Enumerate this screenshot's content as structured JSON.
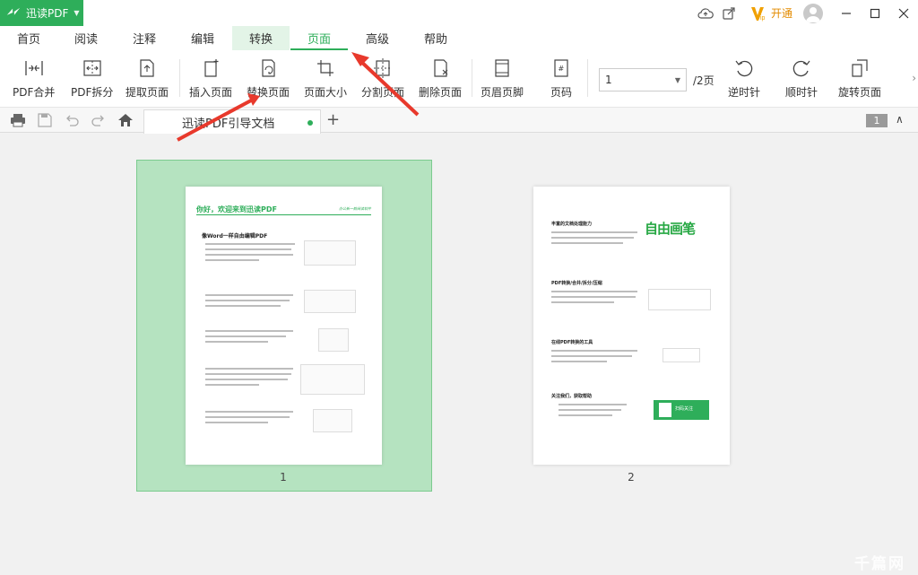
{
  "app": {
    "name": "迅读PDF"
  },
  "titlebar": {
    "vip_text": "开通"
  },
  "menu": {
    "tabs": [
      "首页",
      "阅读",
      "注释",
      "编辑",
      "转换",
      "页面",
      "高级",
      "帮助"
    ],
    "active": "页面"
  },
  "ribbon": {
    "items": [
      "PDF合并",
      "PDF拆分",
      "提取页面",
      "插入页面",
      "替换页面",
      "页面大小",
      "分割页面",
      "删除页面",
      "页眉页脚",
      "页码",
      "逆时针",
      "顺时针",
      "旋转页面"
    ],
    "page_select_value": "1",
    "page_total": "/2页"
  },
  "tabs": {
    "document_title": "迅读PDF引导文档",
    "current_page_badge": "1"
  },
  "pages": {
    "labels": [
      "1",
      "2"
    ],
    "page1": {
      "title": "你好，欢迎来到迅读PDF",
      "subtitle": "办公新一款阅读软件",
      "heading": "像Word一样自由编辑PDF"
    },
    "page2": {
      "logo_text": "自由画笔",
      "headings": [
        "丰富的文档处理能力",
        "PDF转换/合并/拆分/压缩",
        "在线PDF转换的工具",
        "关注我们，获取帮助"
      ],
      "qr_label": "扫码关注"
    }
  },
  "watermark": "千篇网",
  "colors": {
    "accent": "#2eae5a",
    "selection": "#b5e3c0",
    "annotation": "#e8392c"
  }
}
